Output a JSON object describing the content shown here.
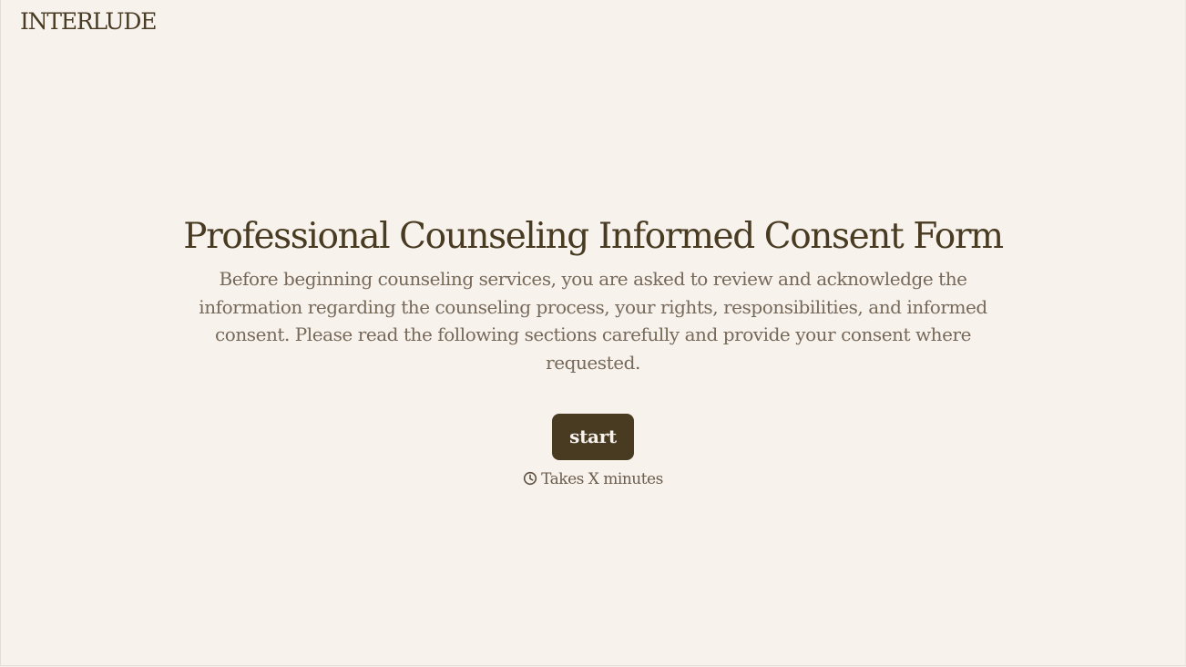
{
  "header": {
    "logo_text": "INTERLUDE"
  },
  "main": {
    "title": "Professional Counseling Informed Consent Form",
    "description": "Before beginning counseling services, you are asked to review and acknowledge the information regarding the counseling process, your rights, responsibilities, and informed consent. Please read the following sections carefully and provide your consent where requested.",
    "start_label": "start",
    "duration_icon": "clock-icon",
    "duration_text": "Takes X minutes"
  },
  "colors": {
    "background": "#f7f2ec",
    "brand": "#483b22",
    "body_text": "#77695a"
  }
}
